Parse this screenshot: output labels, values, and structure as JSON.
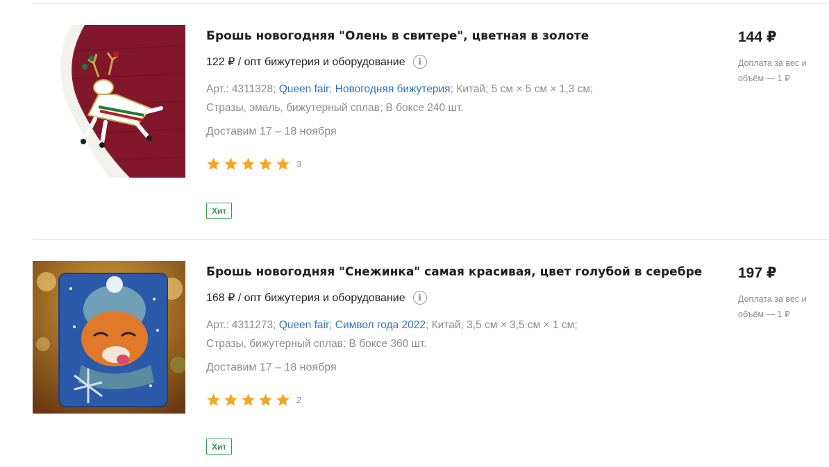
{
  "products": [
    {
      "title": "Брошь новогодняя \"Олень в свитере\", цветная в золоте",
      "wholesale_price": "122 ₽ / опт бижутерия и оборудование",
      "info_icon": "info-icon",
      "art_label": "Арт.: 4311328;",
      "brand": "Queen fair",
      "category": "Новогодняя бижутерия",
      "country": "Китай;",
      "size": "5 см × 5 см × 1,3 см;",
      "materials": "Стразы, эмаль, бижутерный сплав;",
      "box": "В боксе 240 шт.",
      "delivery": "Доставим 17 – 18 ноября",
      "rating": 5,
      "reviews": "3",
      "badge": "Хит",
      "price": "144 ₽",
      "surcharge": "Доплата за вес и объём — 1 ₽"
    },
    {
      "title": "Брошь новогодняя \"Снежинка\" самая красивая, цвет голубой в серебре",
      "wholesale_price": "168 ₽ / опт бижутерия и оборудование",
      "info_icon": "info-icon",
      "art_label": "Арт.: 4311273;",
      "brand": "Queen fair",
      "category": "Символ года 2022",
      "country": "Китай;",
      "size": "3,5 см × 3,5 см × 1 см;",
      "materials": "Стразы, бижутерный сплав;",
      "box": "В боксе 360 шт.",
      "delivery": "Доставим 17 – 18 ноября",
      "rating": 5,
      "reviews": "2",
      "badge": "Хит",
      "price": "197 ₽",
      "surcharge": "Доплата за вес и объём — 1 ₽"
    }
  ],
  "colors": {
    "link": "#2f74c0",
    "badge": "#2e9e4b",
    "star": "#f5a623",
    "muted": "#8c8c8c"
  }
}
